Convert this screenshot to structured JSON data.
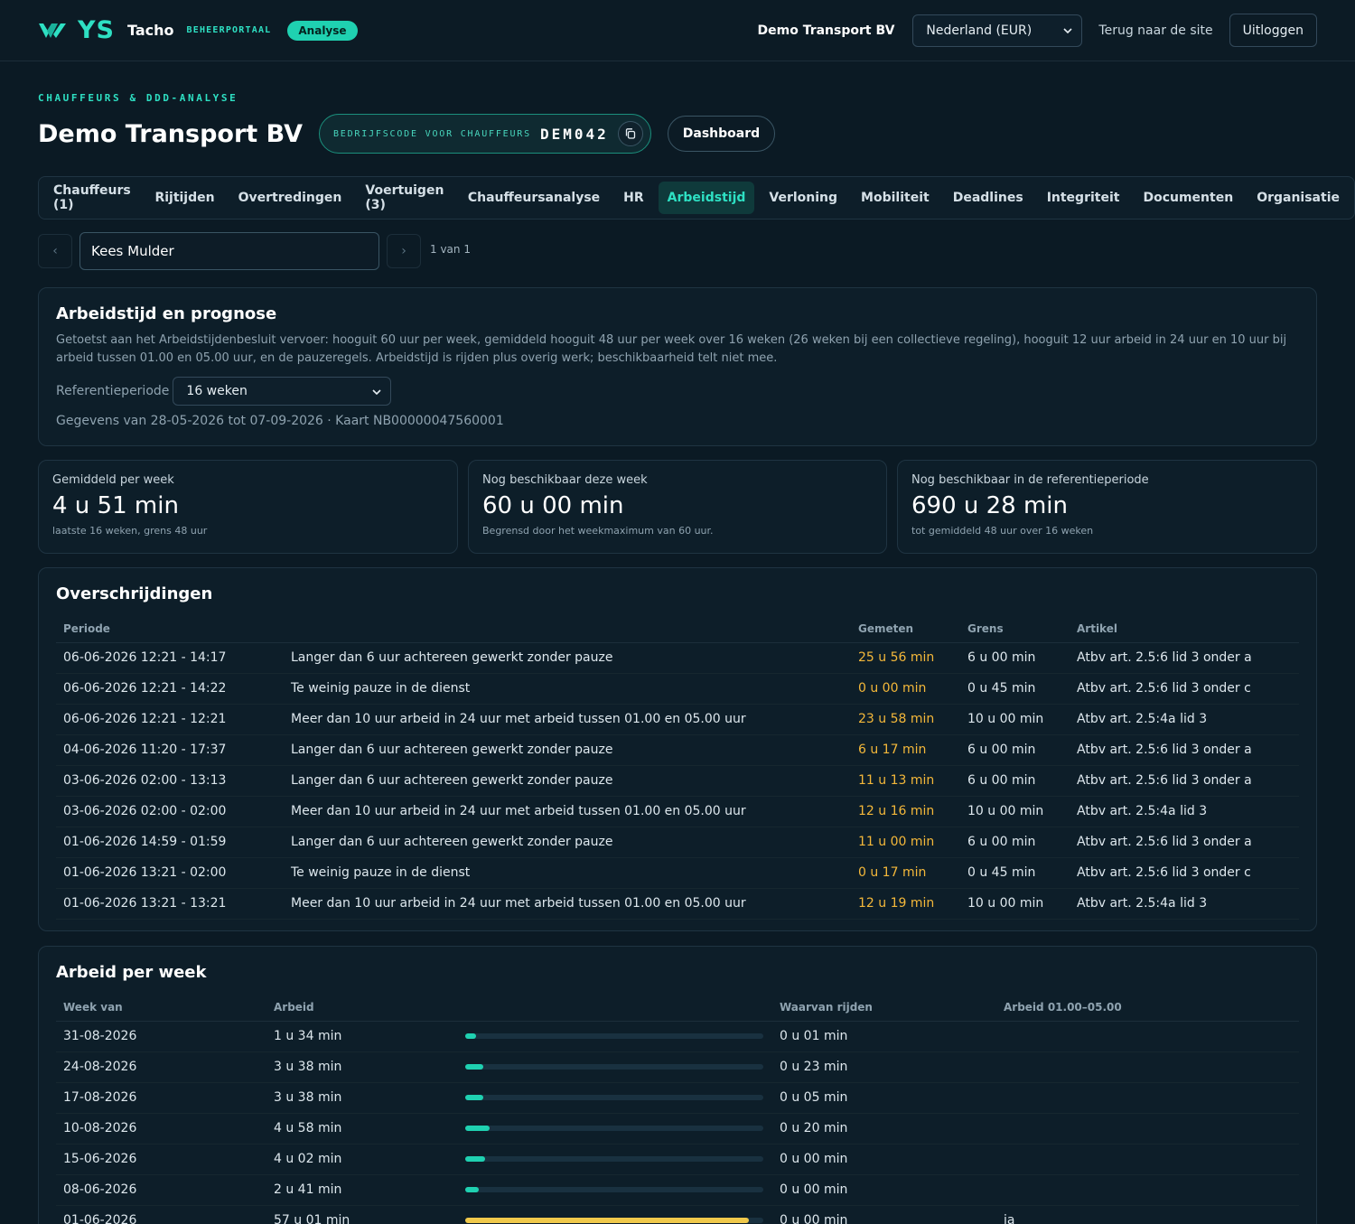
{
  "header": {
    "logo_text": "YS",
    "brand_name": "Tacho",
    "brand_sub": "BEHEERPORTAAL",
    "badge": "Analyse",
    "company": "Demo Transport BV",
    "country_select": "Nederland (EUR)",
    "back_link": "Terug naar de site",
    "logout": "Uitloggen"
  },
  "page": {
    "eyebrow": "CHAUFFEURS & DDD-ANALYSE",
    "title": "Demo Transport BV",
    "code_label": "BEDRIJFSCODE VOOR CHAUFFEURS",
    "code_value": "DEM042",
    "dashboard_button": "Dashboard"
  },
  "tabs": [
    {
      "label": "Chauffeurs (1)"
    },
    {
      "label": "Rijtijden"
    },
    {
      "label": "Overtredingen"
    },
    {
      "label": "Voertuigen (3)"
    },
    {
      "label": "Chauffeursanalyse"
    },
    {
      "label": "HR"
    },
    {
      "label": "Arbeidstijd",
      "active": true
    },
    {
      "label": "Verloning"
    },
    {
      "label": "Mobiliteit"
    },
    {
      "label": "Deadlines"
    },
    {
      "label": "Integriteit"
    },
    {
      "label": "Documenten"
    },
    {
      "label": "Organisatie"
    }
  ],
  "driver": {
    "prev": "‹",
    "name": "Kees Mulder",
    "next": "›",
    "count": "1 van 1"
  },
  "intro": {
    "title": "Arbeidstijd en prognose",
    "description": "Getoetst aan het Arbeidstijdenbesluit vervoer: hooguit 60 uur per week, gemiddeld hooguit 48 uur per week over 16 weken (26 weken bij een collectieve regeling), hooguit 12 uur arbeid in 24 uur en 10 uur bij arbeid tussen 01.00 en 05.00 uur, en de pauzeregels. Arbeidstijd is rijden plus overig werk; beschikbaarheid telt niet mee.",
    "ref_label": "Referentieperiode",
    "ref_value": "16 weken",
    "data_line": "Gegevens van 28-05-2026 tot 07-09-2026 · Kaart NB00000047560001"
  },
  "stats": [
    {
      "label": "Gemiddeld per week",
      "value": "4 u 51 min",
      "sub": "laatste 16 weken, grens 48 uur"
    },
    {
      "label": "Nog beschikbaar deze week",
      "value": "60 u 00 min",
      "sub": "Begrensd door het weekmaximum van 60 uur."
    },
    {
      "label": "Nog beschikbaar in de referentieperiode",
      "value": "690 u 28 min",
      "sub": "tot gemiddeld 48 uur over 16 weken"
    }
  ],
  "violations": {
    "title": "Overschrijdingen",
    "columns": [
      "Periode",
      "",
      "Gemeten",
      "Grens",
      "Artikel"
    ],
    "rows": [
      {
        "period": "06-06-2026 12:21 - 14:17",
        "desc": "Langer dan 6 uur achtereen gewerkt zonder pauze",
        "measured": "25 u 56 min",
        "limit": "6 u 00 min",
        "article": "Atbv art. 2.5:6 lid 3 onder a"
      },
      {
        "period": "06-06-2026 12:21 - 14:22",
        "desc": "Te weinig pauze in de dienst",
        "measured": "0 u 00 min",
        "limit": "0 u 45 min",
        "article": "Atbv art. 2.5:6 lid 3 onder c"
      },
      {
        "period": "06-06-2026 12:21 - 12:21",
        "desc": "Meer dan 10 uur arbeid in 24 uur met arbeid tussen 01.00 en 05.00 uur",
        "measured": "23 u 58 min",
        "limit": "10 u 00 min",
        "article": "Atbv art. 2.5:4a lid 3"
      },
      {
        "period": "04-06-2026 11:20 - 17:37",
        "desc": "Langer dan 6 uur achtereen gewerkt zonder pauze",
        "measured": "6 u 17 min",
        "limit": "6 u 00 min",
        "article": "Atbv art. 2.5:6 lid 3 onder a"
      },
      {
        "period": "03-06-2026 02:00 - 13:13",
        "desc": "Langer dan 6 uur achtereen gewerkt zonder pauze",
        "measured": "11 u 13 min",
        "limit": "6 u 00 min",
        "article": "Atbv art. 2.5:6 lid 3 onder a"
      },
      {
        "period": "03-06-2026 02:00 - 02:00",
        "desc": "Meer dan 10 uur arbeid in 24 uur met arbeid tussen 01.00 en 05.00 uur",
        "measured": "12 u 16 min",
        "limit": "10 u 00 min",
        "article": "Atbv art. 2.5:4a lid 3"
      },
      {
        "period": "01-06-2026 14:59 - 01:59",
        "desc": "Langer dan 6 uur achtereen gewerkt zonder pauze",
        "measured": "11 u 00 min",
        "limit": "6 u 00 min",
        "article": "Atbv art. 2.5:6 lid 3 onder a"
      },
      {
        "period": "01-06-2026 13:21 - 02:00",
        "desc": "Te weinig pauze in de dienst",
        "measured": "0 u 17 min",
        "limit": "0 u 45 min",
        "article": "Atbv art. 2.5:6 lid 3 onder c"
      },
      {
        "period": "01-06-2026 13:21 - 13:21",
        "desc": "Meer dan 10 uur arbeid in 24 uur met arbeid tussen 01.00 en 05.00 uur",
        "measured": "12 u 19 min",
        "limit": "10 u 00 min",
        "article": "Atbv art. 2.5:4a lid 3"
      }
    ]
  },
  "weekly": {
    "title": "Arbeid per week",
    "columns": [
      "Week van",
      "Arbeid",
      "",
      "Waarvan rijden",
      "Arbeid 01.00–05.00"
    ],
    "rows": [
      {
        "week": "31-08-2026",
        "work": "1 u 34 min",
        "fraction": 0.026,
        "driving": "0 u 01 min",
        "night": ""
      },
      {
        "week": "24-08-2026",
        "work": "3 u 38 min",
        "fraction": 0.061,
        "driving": "0 u 23 min",
        "night": ""
      },
      {
        "week": "17-08-2026",
        "work": "3 u 38 min",
        "fraction": 0.061,
        "driving": "0 u 05 min",
        "night": ""
      },
      {
        "week": "10-08-2026",
        "work": "4 u 58 min",
        "fraction": 0.083,
        "driving": "0 u 20 min",
        "night": ""
      },
      {
        "week": "15-06-2026",
        "work": "4 u 02 min",
        "fraction": 0.067,
        "driving": "0 u 00 min",
        "night": ""
      },
      {
        "week": "08-06-2026",
        "work": "2 u 41 min",
        "fraction": 0.045,
        "driving": "0 u 00 min",
        "night": ""
      },
      {
        "week": "01-06-2026",
        "work": "57 u 01 min",
        "fraction": 0.95,
        "driving": "0 u 00 min",
        "night": "ja",
        "warn": true
      }
    ]
  },
  "colors": {
    "accent": "#1fd1b1",
    "warning": "#f4b83a",
    "bar_warning": "#f0c94b",
    "background": "#0b1a24"
  }
}
